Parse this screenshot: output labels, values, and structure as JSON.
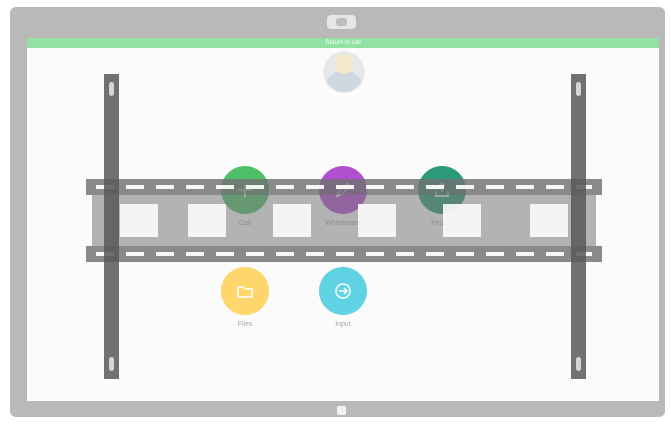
{
  "banner": {
    "text": "Return to call",
    "color": "#92e2a3"
  },
  "apps": [
    {
      "label": "Call",
      "icon": "plus-icon",
      "color": "#4fbf69"
    },
    {
      "label": "Whiteboard",
      "icon": "pencil-icon",
      "color": "#b14fd1"
    },
    {
      "label": "People",
      "icon": "share-tray-icon",
      "color": "#2a9a79"
    },
    {
      "label": "Files",
      "icon": "folder-icon",
      "color": "#ffd66b"
    },
    {
      "label": "Input",
      "icon": "arrow-right-circle-icon",
      "color": "#5fd3e3"
    }
  ]
}
